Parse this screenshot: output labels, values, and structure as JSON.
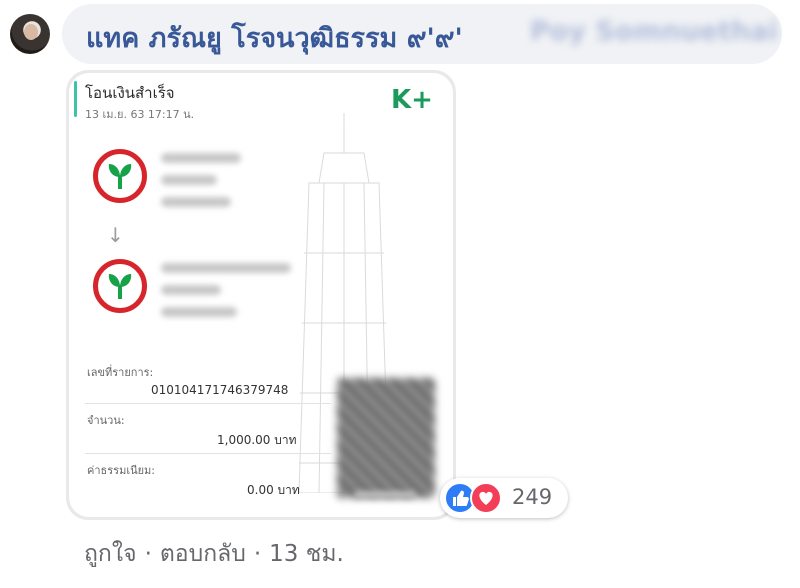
{
  "comment": {
    "author_name": "แทค ภรัณยู โรจนวุฒิธรรม ๙'๙'",
    "author_blurred": "Poy Somnuethai",
    "slip": {
      "title": "โอนเงินสำเร็จ",
      "date": "13 เม.ย. 63   17:17 น.",
      "brand": "K",
      "brand_plus": "+",
      "transaction_label": "เลขที่รายการ:",
      "transaction_id": "0101041717463797​48",
      "amount_label": "จำนวน:",
      "amount_value": "1,000.00 บาท",
      "fee_label": "ค่าธรรมเนียม:",
      "fee_value": "0.00 บาท"
    },
    "reactions": {
      "count": "249"
    },
    "actions": {
      "like": "ถูกใจ",
      "reply": "ตอบกลับ",
      "time": "13 ชม.",
      "separator": "·"
    }
  }
}
